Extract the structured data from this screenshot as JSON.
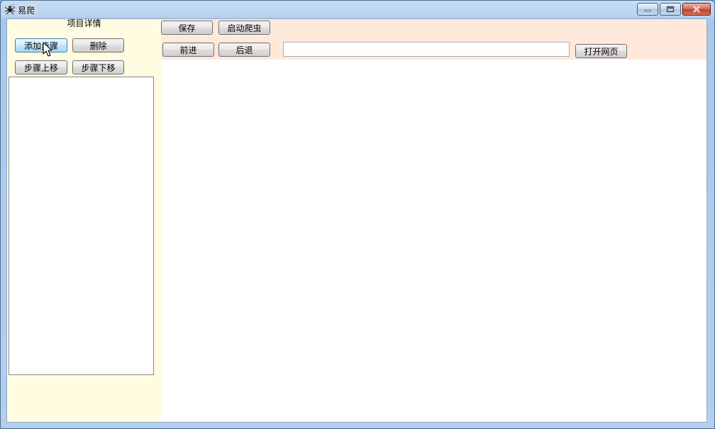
{
  "window": {
    "title": "易爬",
    "icon": "spider-app-icon",
    "controls": {
      "minimize": "minimize-icon",
      "maximize": "maximize-icon",
      "close": "close-icon"
    }
  },
  "left_panel": {
    "title": "项目详情",
    "add_step": "添加步骤",
    "delete": "删除",
    "move_up": "步骤上移",
    "move_down": "步骤下移",
    "steps": []
  },
  "toolbar": {
    "save": "保存",
    "start_crawler": "启动爬虫",
    "forward": "前进",
    "back": "后退",
    "url_value": "",
    "open_page": "打开网页"
  },
  "colors": {
    "left_panel_bg": "#fffce2",
    "toolbar_bg": "#fee9db",
    "titlebar": "#c6dcf2",
    "close_button": "#c3412a"
  }
}
